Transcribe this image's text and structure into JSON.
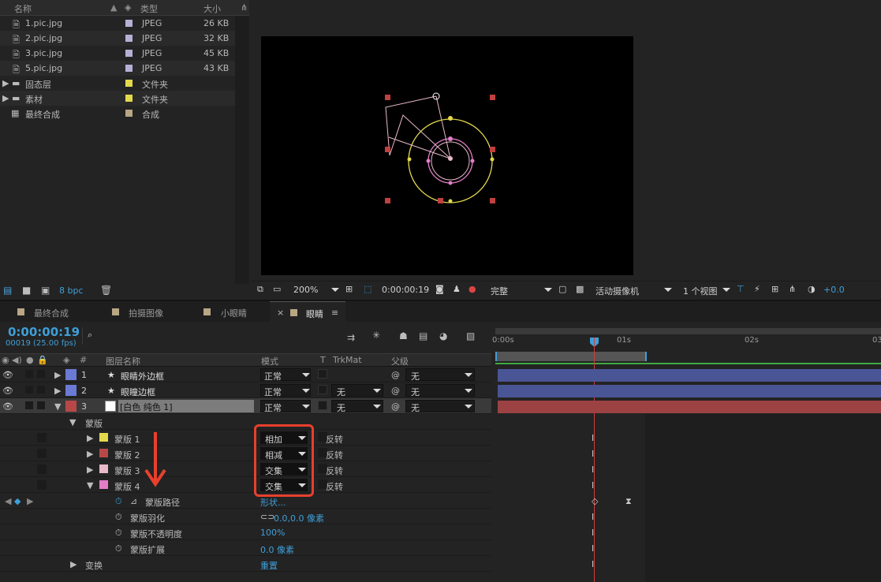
{
  "project": {
    "columns": {
      "name": "名称",
      "type": "类型",
      "size": "大小"
    },
    "items": [
      {
        "name": "1.pic.jpg",
        "type": "JPEG",
        "size": "26 KB",
        "color": "#b6b0d6",
        "icon": "image-file-icon"
      },
      {
        "name": "2.pic.jpg",
        "type": "JPEG",
        "size": "32 KB",
        "color": "#b6b0d6",
        "icon": "image-file-icon"
      },
      {
        "name": "3.pic.jpg",
        "type": "JPEG",
        "size": "45 KB",
        "color": "#b6b0d6",
        "icon": "image-file-icon"
      },
      {
        "name": "5.pic.jpg",
        "type": "JPEG",
        "size": "43 KB",
        "color": "#b6b0d6",
        "icon": "image-file-icon"
      },
      {
        "name": "固态层",
        "type": "文件夹",
        "size": "",
        "color": "#e4d84c",
        "icon": "folder-icon"
      },
      {
        "name": "素材",
        "type": "文件夹",
        "size": "",
        "color": "#e4d84c",
        "icon": "folder-icon"
      },
      {
        "name": "最终合成",
        "type": "合成",
        "size": "",
        "color": "#b8a684",
        "icon": "composition-icon"
      }
    ],
    "bpc": "8 bpc"
  },
  "viewer": {
    "zoom": "200%",
    "timecode": "0:00:00:19",
    "resolution": "完整",
    "camera": "活动摄像机",
    "views": "1 个视图",
    "exposure": "+0.0"
  },
  "tabs": [
    {
      "label": "最终合成",
      "color": "#b8a684",
      "active": false
    },
    {
      "label": "拍摄图像",
      "color": "#b8a684",
      "active": false
    },
    {
      "label": "小眼睛",
      "color": "#b8a684",
      "active": false
    },
    {
      "label": "眼睛",
      "color": "#b8a684",
      "active": true
    }
  ],
  "timeline": {
    "timecode": "0:00:00:19",
    "fps": "00019 (25.00 fps)",
    "search_icon": "search-icon",
    "columns": {
      "num": "#",
      "layer_name": "图层名称",
      "mode": "模式",
      "t": "T",
      "trkmat": "TrkMat",
      "parent": "父级"
    },
    "ruler": [
      "0:00s",
      "01s",
      "02s",
      "03"
    ],
    "layers": [
      {
        "num": "1",
        "name": "眼睛外边框",
        "mode": "正常",
        "trkmat": "",
        "parent": "无",
        "color": "#6b7ad4",
        "bar": "#4a5596"
      },
      {
        "num": "2",
        "name": "眼瞳边框",
        "mode": "正常",
        "trkmat": "无",
        "parent": "无",
        "color": "#6b7ad4",
        "bar": "#4a5596"
      },
      {
        "num": "3",
        "name": "[白色 纯色 1]",
        "mode": "正常",
        "trkmat": "无",
        "parent": "无",
        "color": "#b84848",
        "bar": "#9c4242"
      }
    ],
    "masks_group": "蒙版",
    "masks": [
      {
        "name": "蒙版 1",
        "mode": "相加",
        "invert": "反转",
        "color": "#e4d84c"
      },
      {
        "name": "蒙版 2",
        "mode": "相减",
        "invert": "反转",
        "color": "#b84848"
      },
      {
        "name": "蒙版 3",
        "mode": "交集",
        "invert": "反转",
        "color": "#e7b9c8"
      },
      {
        "name": "蒙版 4",
        "mode": "交集",
        "invert": "反转",
        "color": "#e47ec9"
      }
    ],
    "props": [
      {
        "name": "蒙版路径",
        "value": "形状..."
      },
      {
        "name": "蒙版羽化",
        "value": "0.0,0.0 像素"
      },
      {
        "name": "蒙版不透明度",
        "value": "100%"
      },
      {
        "name": "蒙版扩展",
        "value": "0.0 像素"
      }
    ],
    "transform": {
      "name": "变换",
      "value": "重置"
    }
  }
}
